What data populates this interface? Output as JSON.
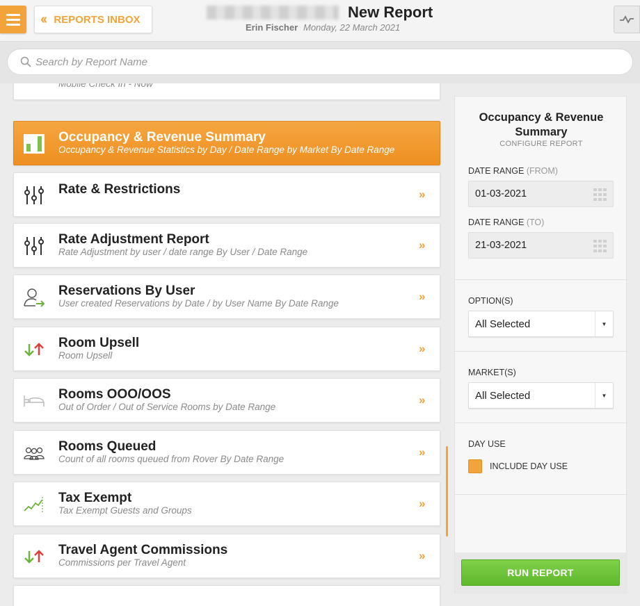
{
  "header": {
    "back_label": "REPORTS INBOX",
    "title": "New Report",
    "user": "Erin Fischer",
    "date": "Monday, 22 March 2021"
  },
  "search": {
    "placeholder": "Search by Report Name"
  },
  "reports": [
    {
      "name": "",
      "desc": "Mobile Check In - Now",
      "icon": "mobile-checkin-icon"
    },
    {
      "name": "Occupancy & Revenue Summary",
      "desc": "Occupancy & Revenue Statistics by Day / Date Range by Market By Date Range",
      "icon": "bar-chart-icon"
    },
    {
      "name": "Rate & Restrictions",
      "desc": "",
      "icon": "sliders-icon"
    },
    {
      "name": "Rate Adjustment Report",
      "desc": "Rate Adjustment by user / date range By User / Date Range",
      "icon": "sliders-icon"
    },
    {
      "name": "Reservations By User",
      "desc": "User created Reservations by Date / by User Name By Date Range",
      "icon": "user-arrow-icon"
    },
    {
      "name": "Room Upsell",
      "desc": "Room Upsell",
      "icon": "up-down-arrows-icon"
    },
    {
      "name": "Rooms OOO/OOS",
      "desc": "Out of Order / Out of Service Rooms by Date Range",
      "icon": "bed-icon"
    },
    {
      "name": "Rooms Queued",
      "desc": "Count of all rooms queued from Rover By Date Range",
      "icon": "people-group-icon"
    },
    {
      "name": "Tax Exempt",
      "desc": "Tax Exempt Guests and Groups",
      "icon": "trend-line-icon"
    },
    {
      "name": "Travel Agent Commissions",
      "desc": "Commissions per Travel Agent",
      "icon": "up-down-arrows-icon"
    }
  ],
  "go_glyph": "»",
  "config": {
    "title": "Occupancy & Revenue Summary",
    "subtitle": "CONFIGURE REPORT",
    "from_label": "DATE RANGE",
    "from_suffix": "(FROM)",
    "from_value": "01-03-2021",
    "to_label": "DATE RANGE",
    "to_suffix": "(TO)",
    "to_value": "21-03-2021",
    "options_label": "OPTION(S)",
    "options_value": "All Selected",
    "markets_label": "MARKET(S)",
    "markets_value": "All Selected",
    "dayuse_label": "DAY USE",
    "include_dayuse_label": "INCLUDE DAY USE",
    "include_dayuse_checked": true,
    "run_label": "RUN REPORT"
  },
  "colors": {
    "accent": "#f2a33a",
    "run": "#6cc43a",
    "up_arrow": "#d9413a",
    "down_arrow": "#6cb33f"
  }
}
